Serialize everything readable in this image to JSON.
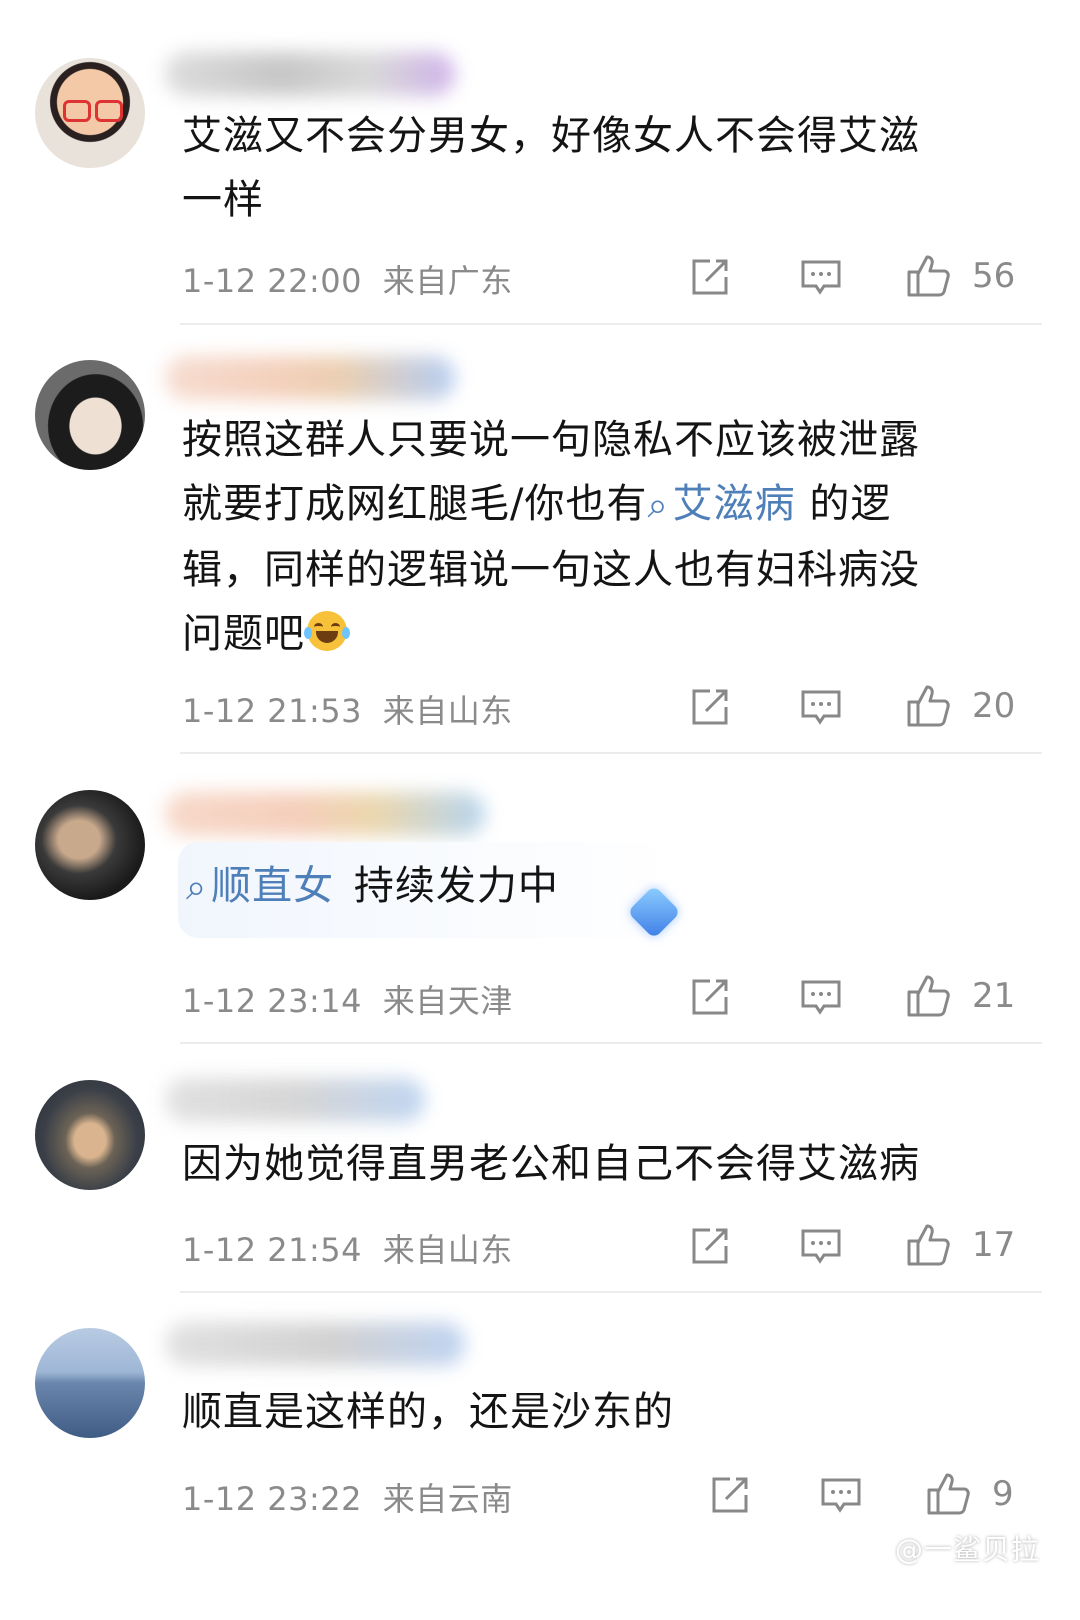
{
  "comments": [
    {
      "text_lines": [
        "艾滋又不会分男女，好像女人不会得艾滋",
        "一样"
      ],
      "time": "1-12 22:00",
      "location": "来自广东",
      "likes": "56"
    },
    {
      "line1": "按照这群人只要说一句隐私不应该被泄露",
      "line2_before": "就要打成网红腿毛/你也有",
      "line2_topic": "艾滋病",
      "line2_after": " 的逻",
      "line3": "辑，同样的逻辑说一句这人也有妇科病没",
      "line4": "问题吧",
      "emoji": "laugh-cry-emoji",
      "time": "1-12 21:53",
      "location": "来自山东",
      "likes": "20"
    },
    {
      "topic": "顺直女",
      "badge_text": "持续发力中",
      "time": "1-12 23:14",
      "location": "来自天津",
      "likes": "21"
    },
    {
      "text": "因为她觉得直男老公和自己不会得艾滋病",
      "time": "1-12 21:54",
      "location": "来自山东",
      "likes": "17"
    },
    {
      "text": "顺直是这样的，还是沙东的",
      "time": "1-12 23:22",
      "location": "来自云南",
      "likes": "9"
    }
  ],
  "icons": {
    "share": "share-icon",
    "reply": "comment-icon",
    "like": "thumbs-up-icon"
  },
  "watermark": "@一鲨贝拉",
  "colors": {
    "topic": "#4f7fb8",
    "meta": "#8a8a8a",
    "text": "#141414"
  }
}
